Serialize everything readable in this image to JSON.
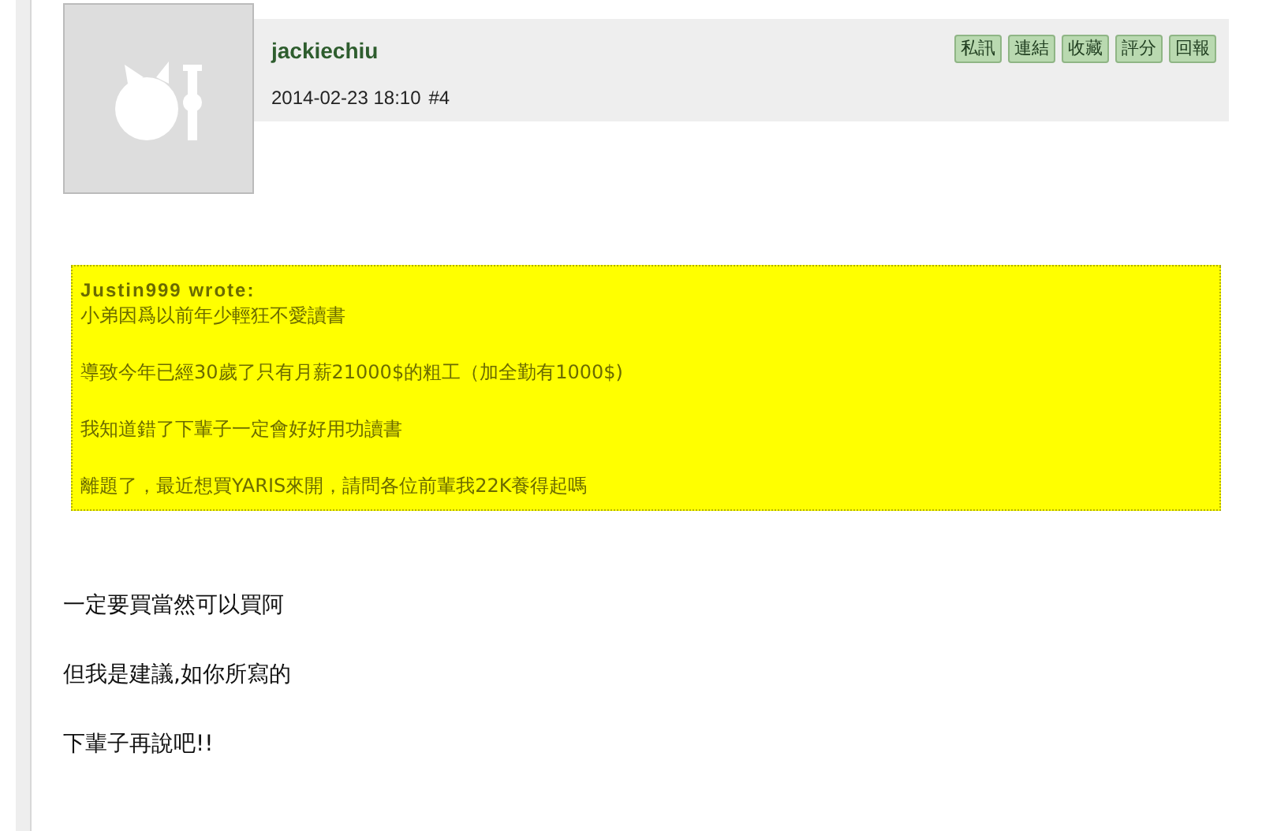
{
  "post": {
    "author": "jackiechiu",
    "timestamp": "2014-02-23 18:10",
    "post_number": "#4",
    "actions": [
      "私訊",
      "連結",
      "收藏",
      "評分",
      "回報"
    ],
    "quote": {
      "attribution": "Justin999 wrote:",
      "paragraphs": [
        "小弟因爲以前年少輕狂不愛讀書",
        "導致今年已經30歲了只有月薪21000$的粗工（加全勤有1000$)",
        "我知道錯了下輩子一定會好好用功讀書",
        "離題了，最近想買YARIS來開，請問各位前輩我22K養得起嗎"
      ]
    },
    "body": [
      "一定要買當然可以買阿",
      "但我是建議,如你所寫的",
      "下輩子再說吧!!"
    ]
  }
}
